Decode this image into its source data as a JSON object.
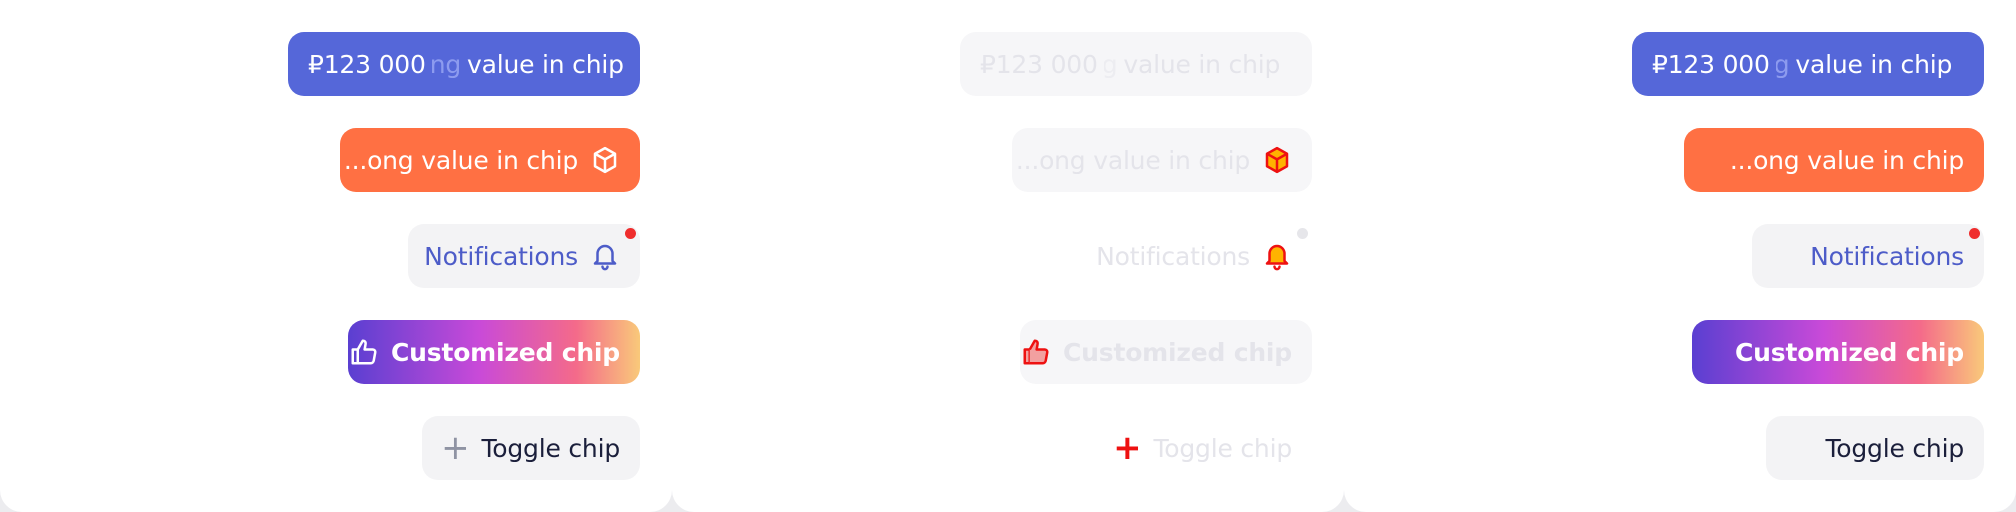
{
  "colors": {
    "primary": "#5567d9",
    "accent_orange": "#ff7043",
    "neutral_chip": "#f3f3f5",
    "badge_red": "#ef2d2d",
    "disabled_text": "#e4e4ea"
  },
  "panels": [
    {
      "state": "enabled",
      "price_value": "₽123 000",
      "price_fade": "ng",
      "price_label": "value in chip",
      "long_label": "...ong value in chip",
      "notif_label": "Notifications",
      "custom_label": "Customized chip",
      "toggle_label": "Toggle chip"
    },
    {
      "state": "disabled",
      "price_value": "₽123 000",
      "price_fade": "g",
      "price_label": "value in chip",
      "long_label": "...ong value in chip",
      "notif_label": "Notifications",
      "custom_label": "Customized chip",
      "toggle_label": "Toggle chip"
    },
    {
      "state": "no-icons",
      "price_value": "₽123 000",
      "price_fade": "g",
      "price_label": "value in chip",
      "long_label": "...ong value in chip",
      "notif_label": "Notifications",
      "custom_label": "Customized chip",
      "toggle_label": "Toggle chip"
    }
  ],
  "icons": {
    "cube": "cube-icon",
    "bell": "bell-icon",
    "thumb": "thumbs-up-icon",
    "plus": "plus-icon"
  }
}
